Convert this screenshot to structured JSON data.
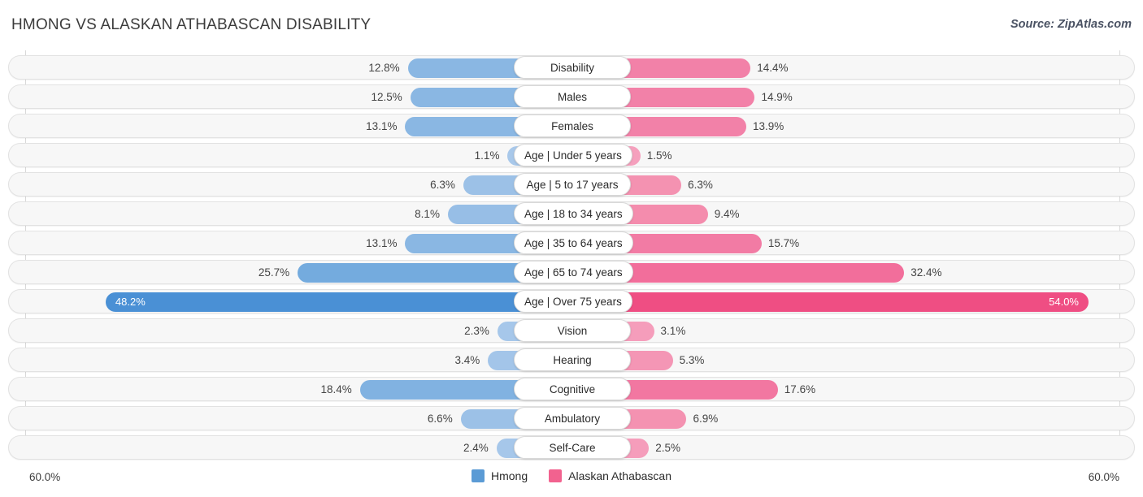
{
  "header": {
    "title": "HMONG VS ALASKAN ATHABASCAN DISABILITY",
    "source": "Source: ZipAtlas.com"
  },
  "axis": {
    "left_max": "60.0%",
    "right_max": "60.0%"
  },
  "legend": {
    "items": [
      {
        "label": "Hmong",
        "color": "#5b9bd5"
      },
      {
        "label": "Alaskan Athabascan",
        "color": "#f2628f"
      }
    ]
  },
  "chart_data": {
    "type": "bar",
    "title": "HMONG VS ALASKAN ATHABASCAN DISABILITY",
    "subtitle": "Source: ZipAtlas.com",
    "orientation": "horizontal-diverging",
    "xlabel": "",
    "ylabel": "",
    "xlim": [
      0,
      60
    ],
    "axis_max_label": "60.0%",
    "grid": false,
    "legend_position": "bottom-center",
    "categories": [
      "Disability",
      "Males",
      "Females",
      "Age | Under 5 years",
      "Age | 5 to 17 years",
      "Age | 18 to 34 years",
      "Age | 35 to 64 years",
      "Age | 65 to 74 years",
      "Age | Over 75 years",
      "Vision",
      "Hearing",
      "Cognitive",
      "Ambulatory",
      "Self-Care"
    ],
    "series": [
      {
        "name": "Hmong",
        "color": "#5b9bd5",
        "values": [
          12.8,
          12.5,
          13.1,
          1.1,
          6.3,
          8.1,
          13.1,
          25.7,
          48.2,
          2.3,
          3.4,
          18.4,
          6.6,
          2.4
        ],
        "labels": [
          "12.8%",
          "12.5%",
          "13.1%",
          "1.1%",
          "6.3%",
          "8.1%",
          "13.1%",
          "25.7%",
          "48.2%",
          "2.3%",
          "3.4%",
          "18.4%",
          "6.6%",
          "2.4%"
        ]
      },
      {
        "name": "Alaskan Athabascan",
        "color": "#f2628f",
        "values": [
          14.4,
          14.9,
          13.9,
          1.5,
          6.3,
          9.4,
          15.7,
          32.4,
          54.0,
          3.1,
          5.3,
          17.6,
          6.9,
          2.5
        ],
        "labels": [
          "14.4%",
          "14.9%",
          "13.9%",
          "1.5%",
          "6.3%",
          "9.4%",
          "15.7%",
          "32.4%",
          "54.0%",
          "3.1%",
          "5.3%",
          "17.6%",
          "6.9%",
          "2.5%"
        ]
      }
    ]
  },
  "rows": [
    {
      "label": "Disability",
      "left_value": "12.8%",
      "right_value": "14.4%",
      "left_num": 12.8,
      "right_num": 14.4,
      "left_color": "#8ab7e3",
      "right_color": "#f281a8",
      "left_inside": false,
      "right_inside": false
    },
    {
      "label": "Males",
      "left_value": "12.5%",
      "right_value": "14.9%",
      "left_num": 12.5,
      "right_num": 14.9,
      "left_color": "#8ab7e3",
      "right_color": "#f281a8",
      "left_inside": false,
      "right_inside": false
    },
    {
      "label": "Females",
      "left_value": "13.1%",
      "right_value": "13.9%",
      "left_num": 13.1,
      "right_num": 13.9,
      "left_color": "#8ab7e3",
      "right_color": "#f281a8",
      "left_inside": false,
      "right_inside": false
    },
    {
      "label": "Age | Under 5 years",
      "left_value": "1.1%",
      "right_value": "1.5%",
      "left_num": 1.1,
      "right_num": 1.5,
      "left_color": "#a8c8ea",
      "right_color": "#f5a0bd",
      "left_inside": false,
      "right_inside": false
    },
    {
      "label": "Age | 5 to 17 years",
      "left_value": "6.3%",
      "right_value": "6.3%",
      "left_num": 6.3,
      "right_num": 6.3,
      "left_color": "#9cc1e7",
      "right_color": "#f492b1",
      "left_inside": false,
      "right_inside": false
    },
    {
      "label": "Age | 18 to 34 years",
      "left_value": "8.1%",
      "right_value": "9.4%",
      "left_num": 8.1,
      "right_num": 9.4,
      "left_color": "#97bee6",
      "right_color": "#f48cad",
      "left_inside": false,
      "right_inside": false
    },
    {
      "label": "Age | 35 to 64 years",
      "left_value": "13.1%",
      "right_value": "15.7%",
      "left_num": 13.1,
      "right_num": 15.7,
      "left_color": "#8ab7e3",
      "right_color": "#f27ba4",
      "left_inside": false,
      "right_inside": false
    },
    {
      "label": "Age | 65 to 74 years",
      "left_value": "25.7%",
      "right_value": "32.4%",
      "left_num": 25.7,
      "right_num": 32.4,
      "left_color": "#74abde",
      "right_color": "#f26e9b",
      "left_inside": false,
      "right_inside": false
    },
    {
      "label": "Age | Over 75 years",
      "left_value": "48.2%",
      "right_value": "54.0%",
      "left_num": 48.2,
      "right_num": 54.0,
      "left_color": "#4a90d5",
      "right_color": "#ef4e83",
      "left_inside": true,
      "right_inside": true
    },
    {
      "label": "Vision",
      "left_value": "2.3%",
      "right_value": "3.1%",
      "left_num": 2.3,
      "right_num": 3.1,
      "left_color": "#a6c7ea",
      "right_color": "#f59dbb",
      "left_inside": false,
      "right_inside": false
    },
    {
      "label": "Hearing",
      "left_value": "3.4%",
      "right_value": "5.3%",
      "left_num": 3.4,
      "right_num": 5.3,
      "left_color": "#a3c5e9",
      "right_color": "#f496b5",
      "left_inside": false,
      "right_inside": false
    },
    {
      "label": "Cognitive",
      "left_value": "18.4%",
      "right_value": "17.6%",
      "left_num": 18.4,
      "right_num": 17.6,
      "left_color": "#81b2e1",
      "right_color": "#f277a1",
      "left_inside": false,
      "right_inside": false
    },
    {
      "label": "Ambulatory",
      "left_value": "6.6%",
      "right_value": "6.9%",
      "left_num": 6.6,
      "right_num": 6.9,
      "left_color": "#9cc1e7",
      "right_color": "#f492b1",
      "left_inside": false,
      "right_inside": false
    },
    {
      "label": "Self-Care",
      "left_value": "2.4%",
      "right_value": "2.5%",
      "left_num": 2.4,
      "right_num": 2.5,
      "left_color": "#a6c7ea",
      "right_color": "#f59dbb",
      "left_inside": false,
      "right_inside": false
    }
  ]
}
